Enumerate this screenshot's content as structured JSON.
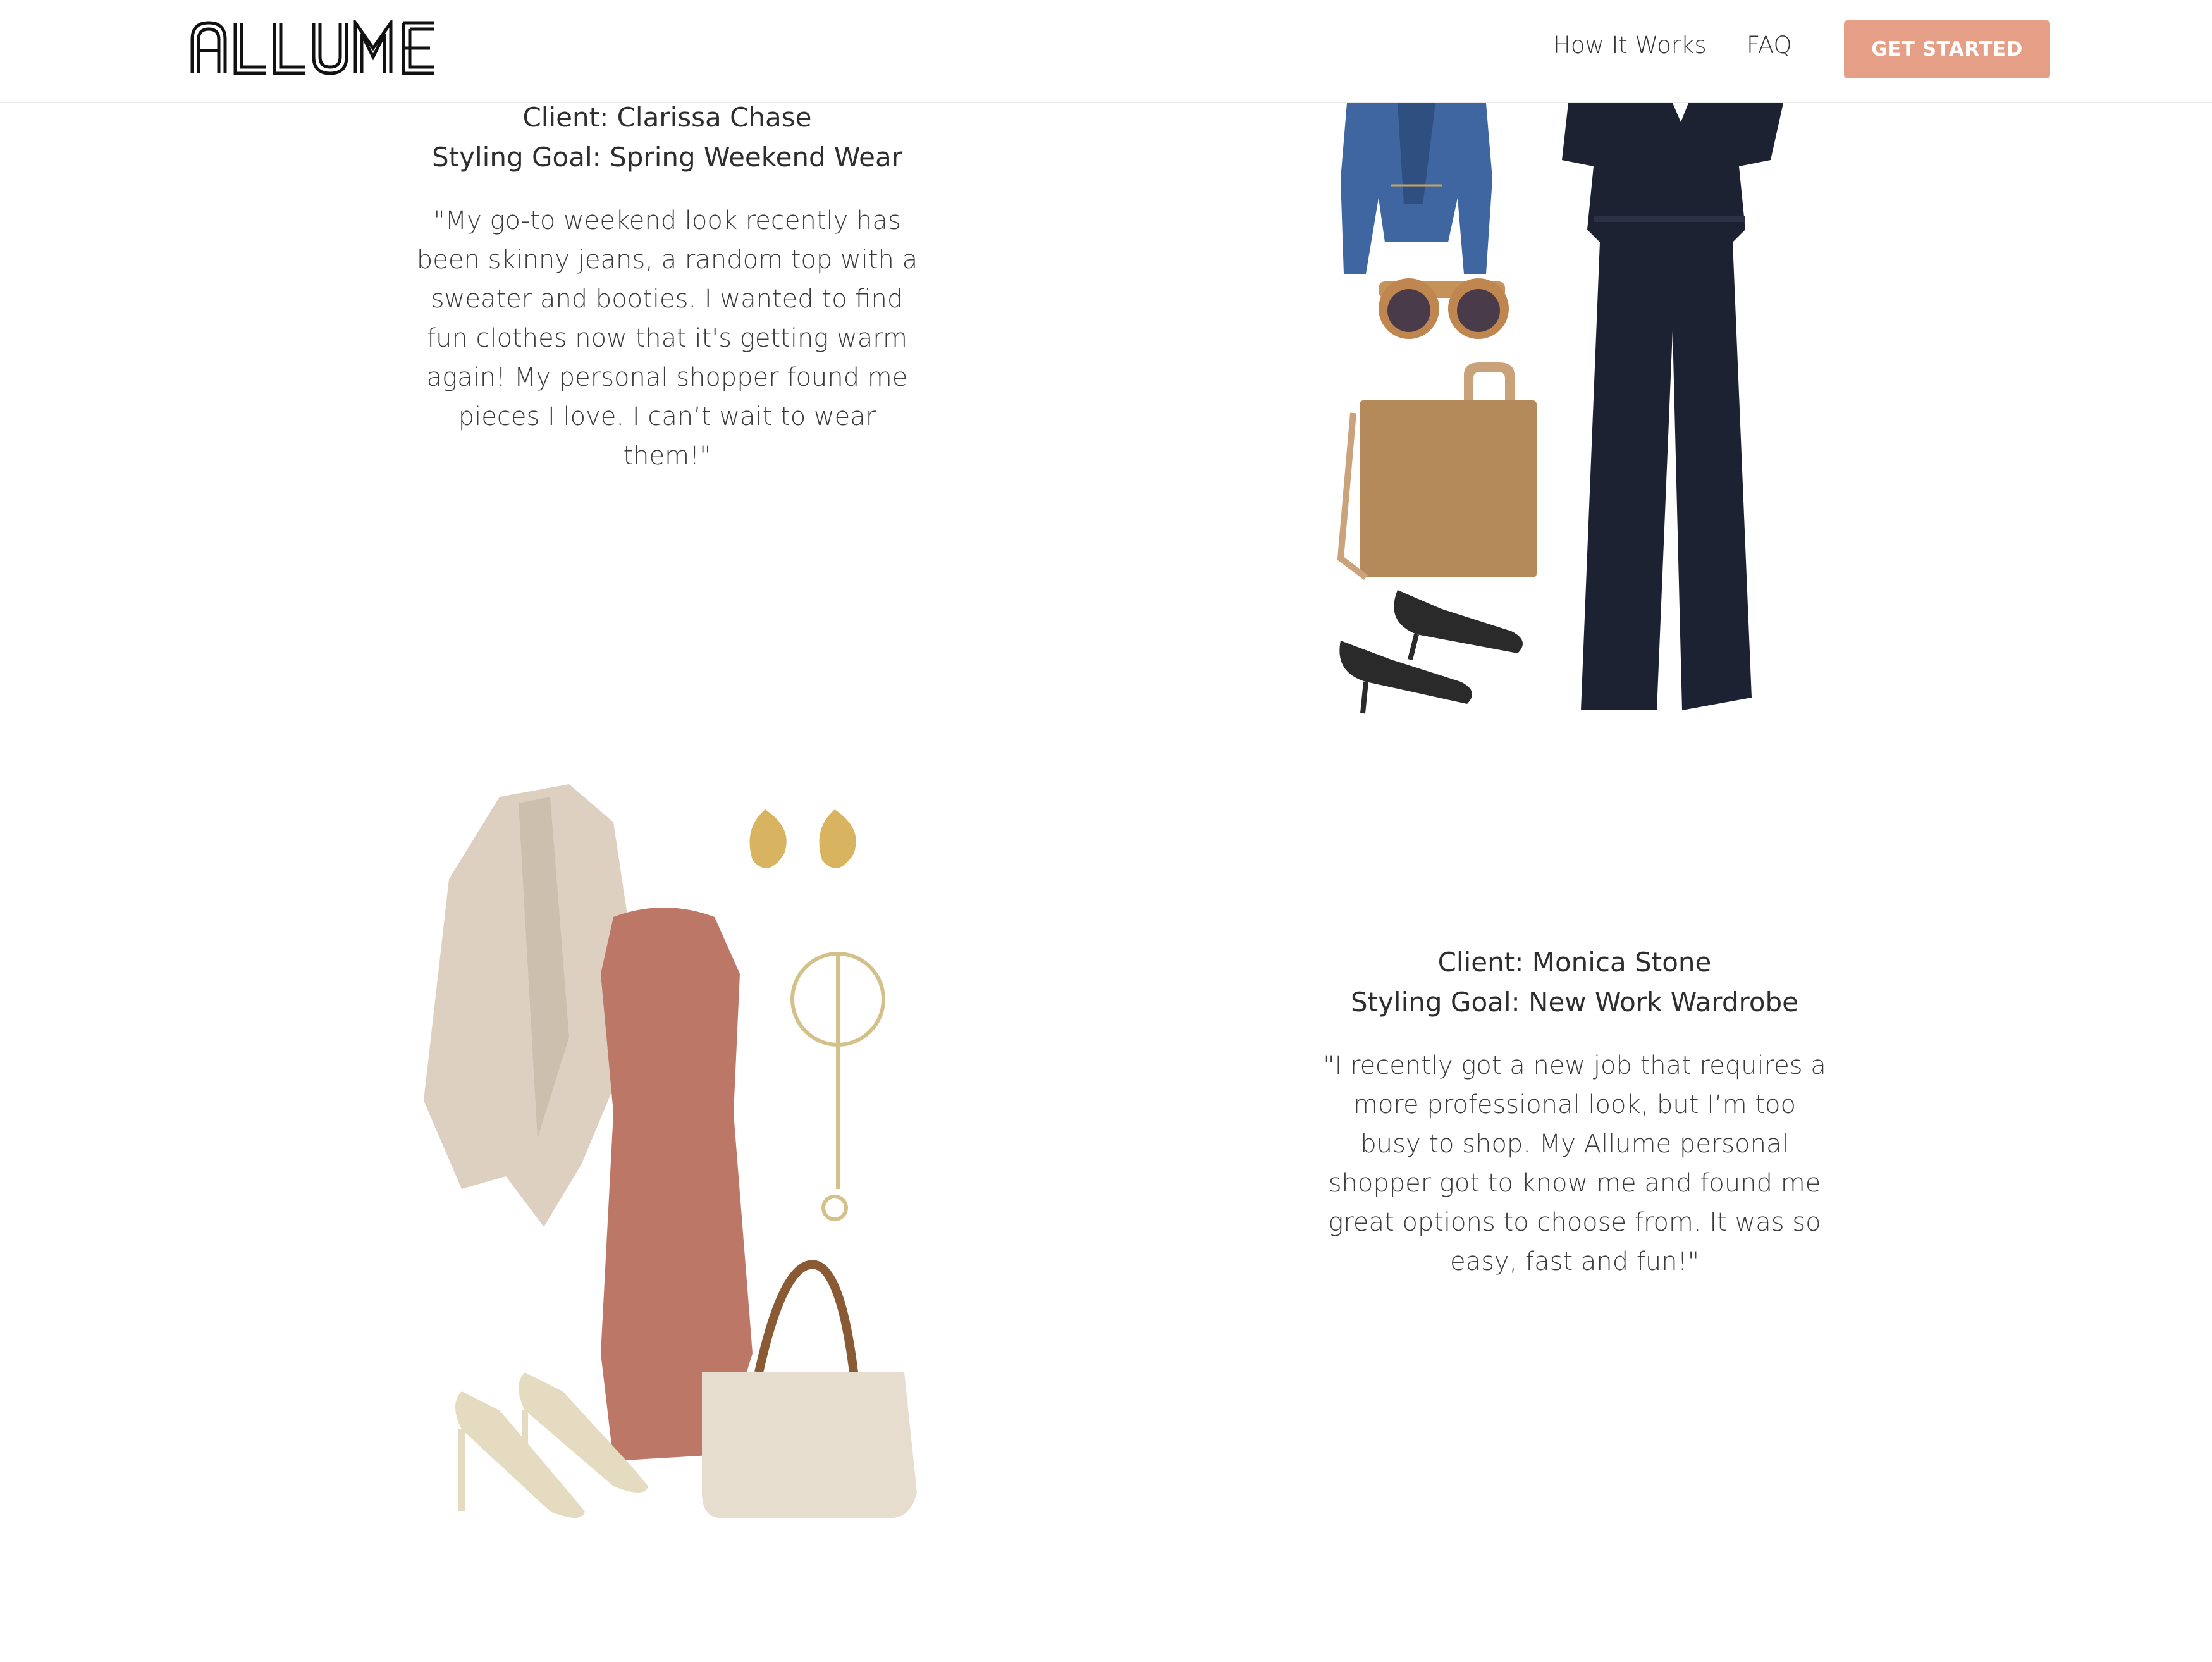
{
  "header": {
    "logo_text": "ALLUME",
    "nav": [
      {
        "label": "How It Works"
      },
      {
        "label": "FAQ"
      }
    ],
    "cta_label": "GET STARTED"
  },
  "testimonials": [
    {
      "client_line": "Client: Clarissa Chase",
      "goal_line": "Styling Goal: Spring Weekend Wear",
      "quote": "\"My go-to weekend look recently has been skinny jeans, a random top with a sweater and booties. I wanted to find fun clothes now that it's getting warm again! My personal shopper found me pieces I love. I can’t wait to wear them!\""
    },
    {
      "client_line": "Client: Monica Stone",
      "goal_line": "Styling Goal: New Work Wardrobe",
      "quote": "\"I recently got a new job that requires a more professional look, but I’m too busy to shop. My Allume personal shopper got to know me and found me great options to choose from. It was so easy, fast and fun!\""
    }
  ],
  "colors": {
    "accent": "#e59f87",
    "text": "#2e2e2e"
  }
}
